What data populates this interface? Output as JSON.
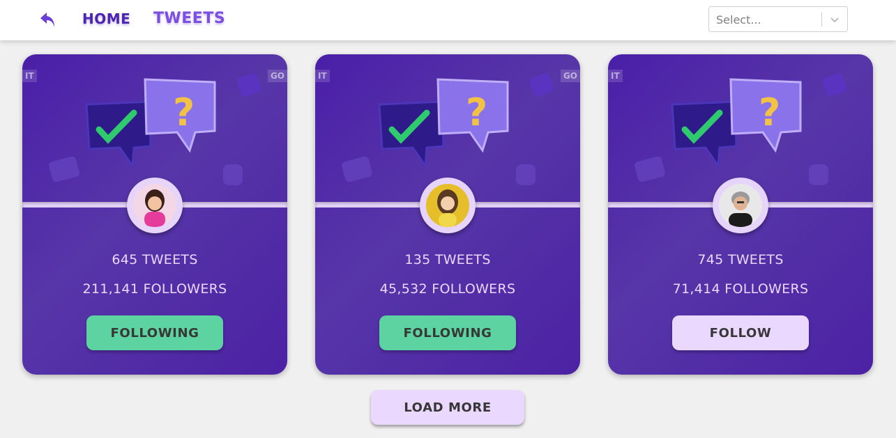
{
  "header": {
    "home_label": "HOME",
    "tweets_label": "TWEETS",
    "select_placeholder": "Select..."
  },
  "cards": [
    {
      "tweets": "645 TWEETS",
      "followers": "211,141 FOLLOWERS",
      "button_label": "FOLLOWING",
      "state": "following",
      "logo_left": "IT",
      "logo_right": "GO"
    },
    {
      "tweets": "135 TWEETS",
      "followers": "45,532 FOLLOWERS",
      "button_label": "FOLLOWING",
      "state": "following",
      "logo_left": "IT",
      "logo_right": "GO"
    },
    {
      "tweets": "745 TWEETS",
      "followers": "71,414 FOLLOWERS",
      "button_label": "FOLLOW",
      "state": "not-following",
      "logo_left": "IT",
      "logo_right": ""
    }
  ],
  "load_more_label": "LOAD MORE",
  "colors": {
    "accent": "#4b25b0",
    "card_bg": "#4a1fa8",
    "following_btn": "#5cd3a1",
    "follow_btn": "#ebd8ff"
  }
}
